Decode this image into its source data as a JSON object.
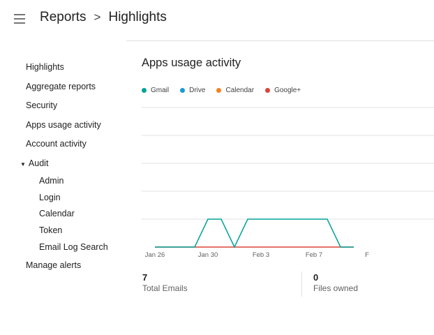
{
  "header": {
    "title": "Reports",
    "separator": ">",
    "subtitle": "Highlights",
    "menu_icon": "hamburger-menu-icon"
  },
  "sidebar": {
    "items": [
      {
        "label": "Highlights"
      },
      {
        "label": "Aggregate reports"
      },
      {
        "label": "Security"
      },
      {
        "label": "Apps usage activity"
      },
      {
        "label": "Account activity"
      },
      {
        "label": "Audit",
        "expanded": true
      },
      {
        "label": "Admin"
      },
      {
        "label": "Login"
      },
      {
        "label": "Calendar"
      },
      {
        "label": "Token"
      },
      {
        "label": "Email Log Search"
      },
      {
        "label": "Manage alerts"
      }
    ]
  },
  "main": {
    "title": "Apps usage activity",
    "legend": [
      {
        "name": "Gmail",
        "color": "#00a397"
      },
      {
        "name": "Drive",
        "color": "#1a9ad6"
      },
      {
        "name": "Calendar",
        "color": "#f5821f"
      },
      {
        "name": "Google+",
        "color": "#db4437"
      }
    ]
  },
  "chart_data": {
    "type": "line",
    "x": [
      "Jan 26",
      "Jan 27",
      "Jan 28",
      "Jan 29",
      "Jan 30",
      "Jan 31",
      "Feb 1",
      "Feb 2",
      "Feb 3",
      "Feb 4",
      "Feb 5",
      "Feb 6",
      "Feb 7",
      "Feb 8",
      "Feb 9",
      "Feb 10"
    ],
    "x_tick_labels": [
      "Jan 26",
      "Jan 30",
      "Feb 3",
      "Feb 7",
      "F"
    ],
    "series": [
      {
        "name": "Gmail",
        "color": "#00a397",
        "values": [
          0,
          0,
          0,
          0,
          1,
          1,
          0,
          1,
          1,
          1,
          1,
          1,
          1,
          1,
          0,
          0
        ]
      },
      {
        "name": "Google+",
        "color": "#db4437",
        "values": [
          0,
          0,
          0,
          0,
          0,
          0,
          0,
          0,
          0,
          0,
          0,
          0,
          0,
          0,
          0,
          0
        ]
      }
    ],
    "ylim": [
      0,
      5
    ],
    "grid": true,
    "legend": "top-left"
  },
  "stats": [
    {
      "value": "7",
      "label": "Total Emails"
    },
    {
      "value": "0",
      "label": "Files owned"
    }
  ]
}
